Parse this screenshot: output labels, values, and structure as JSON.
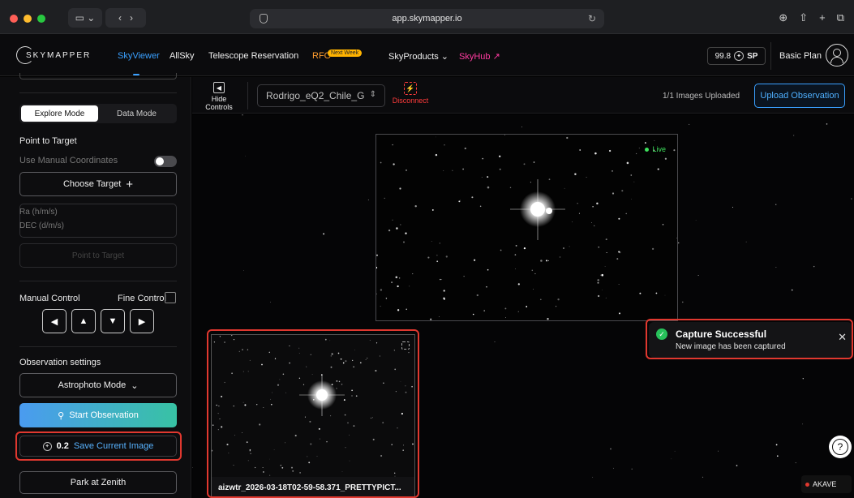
{
  "browser": {
    "url": "app.skymapper.io"
  },
  "nav": {
    "logo": "SKYMAPPER",
    "items": [
      {
        "label": "SkyViewer",
        "active": true
      },
      {
        "label": "AllSky"
      },
      {
        "label": "Telescope Reservation"
      },
      {
        "label": "RFO",
        "badge": "Next Week"
      },
      {
        "label": "SkyProducts ⌄"
      },
      {
        "label": "SkyHub ↗"
      }
    ],
    "sp_value": "99.8",
    "sp_unit": "SP",
    "plan": "Basic Plan"
  },
  "sidebar": {
    "modes": [
      "Explore Mode",
      "Data Mode"
    ],
    "active_mode": "Explore Mode",
    "point_to_target": "Point to Target",
    "use_manual_coordinates": "Use Manual Coordinates",
    "manual_coordinates_enabled": false,
    "choose_target": "Choose Target",
    "ra_placeholder": "Ra (h/m/s)",
    "dec_placeholder": "DEC (d/m/s)",
    "point_button": "Point to Target",
    "manual_control": "Manual Control",
    "fine_control": "Fine Control",
    "fine_control_checked": false,
    "observation_settings": "Observation settings",
    "mode_select": "Astrophoto Mode",
    "start_observation": "Start Observation",
    "save_cost": "0.2",
    "save_current_image": "Save Current Image",
    "park_at_zenith": "Park at Zenith"
  },
  "toolbar": {
    "hide_controls": "Hide Controls",
    "telescope": "Rodrigo_eQ2_Chile_G",
    "disconnect": "Disconnect",
    "uploaded_status": "1/1 Images Uploaded",
    "upload_button": "Upload Observation"
  },
  "viewer": {
    "live_label": "Live",
    "thumbnail_caption": "aizwtr_2026-03-18T02-59-58.371_PRETTYPICT..."
  },
  "toast": {
    "title": "Capture Successful",
    "message": "New image has been captured"
  },
  "footer": {
    "help": "?",
    "akave": "AKAVE"
  },
  "colors": {
    "accent_blue": "#3aa0ff",
    "rfo_orange": "#ff9d2e",
    "skyhub_pink": "#ff3ba0",
    "live_green": "#3ee35d",
    "highlight_red": "#e0382f"
  }
}
